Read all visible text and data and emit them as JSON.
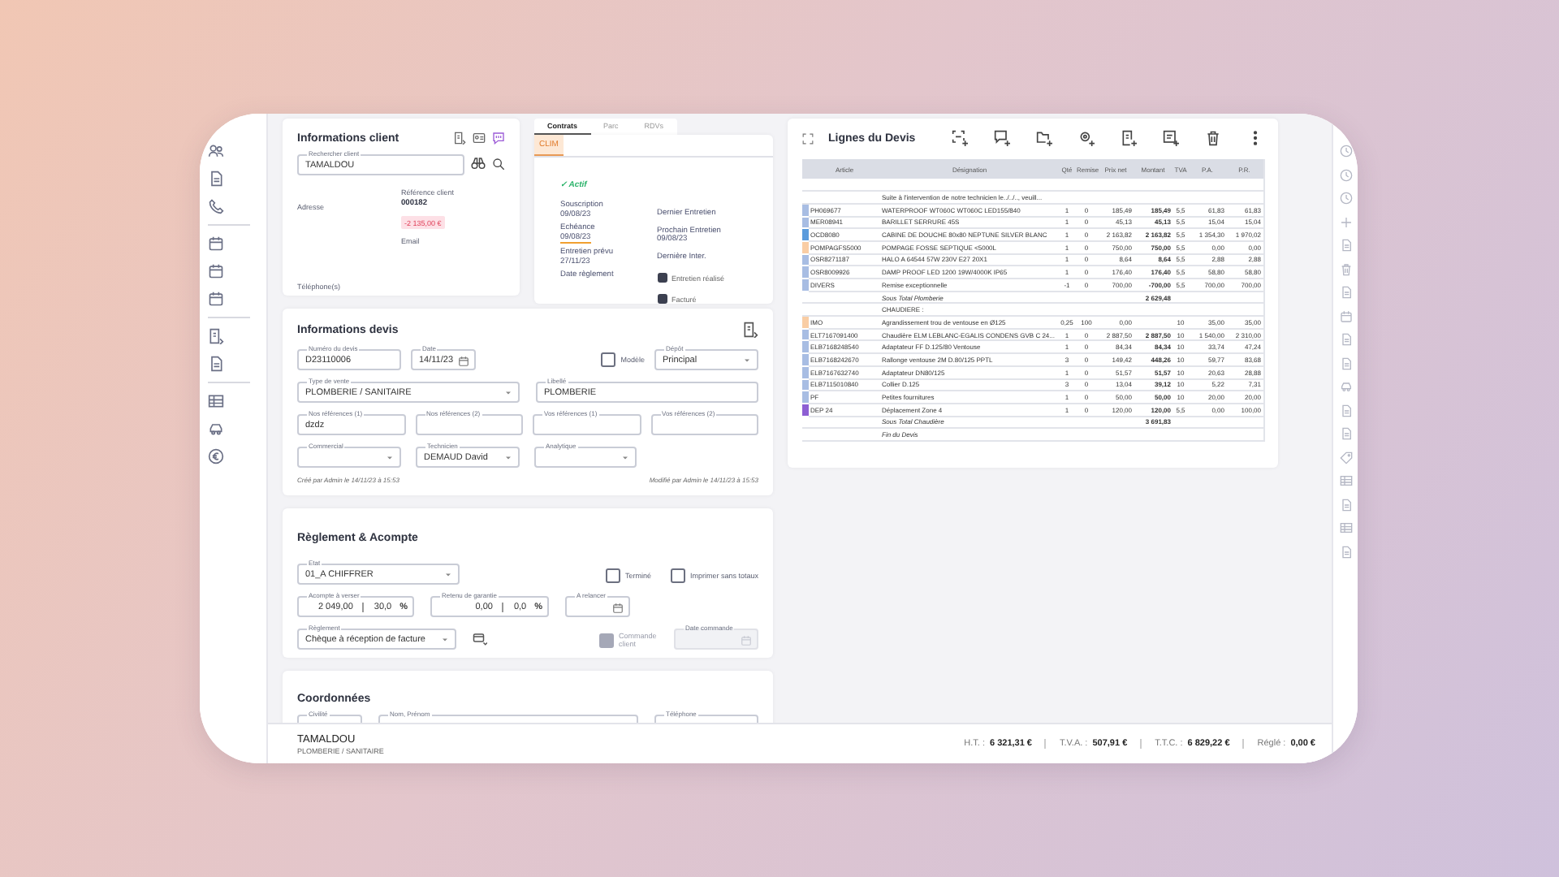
{
  "client": {
    "title": "Informations client",
    "search": {
      "label": "Rechercher client",
      "value": "TAMALDOU"
    },
    "address_label": "Adresse",
    "reference_label": "Référence client",
    "reference": "000182",
    "balance": "-2 135,00 €",
    "email_label": "Email",
    "phone_label": "Téléphone(s)"
  },
  "contracts": {
    "tabs": [
      {
        "label": "Contrats",
        "selected": true
      },
      {
        "label": "Parc",
        "selected": false
      },
      {
        "label": "RDVs",
        "selected": false
      }
    ],
    "contract_tabs": [
      {
        "label": "CLIM",
        "selected": true
      }
    ],
    "status": "✓ Actif",
    "left_fields": [
      {
        "label": "Souscription",
        "value": "09/08/23",
        "highlighted": false
      },
      {
        "label": "Echéance",
        "value": "09/08/23",
        "highlighted": true
      },
      {
        "label": "Entretien prévu",
        "value": "27/11/23",
        "highlighted": false
      },
      {
        "label": "Date règlement",
        "highlighted": false
      }
    ],
    "right_fields": [
      {
        "label": "Dernier Entretien"
      },
      {
        "label": "Prochain Entretien",
        "value": "09/08/23"
      },
      {
        "label": "Dernière Inter."
      }
    ],
    "checks": [
      {
        "label": "Entretien réalisé",
        "checked": true
      },
      {
        "label": "Facturé",
        "checked": true
      }
    ]
  },
  "devis": {
    "title": "Informations devis",
    "fields": [
      {
        "kind": "text",
        "label": "Numéro du devis",
        "value": "D23110006"
      },
      {
        "kind": "date",
        "label": "Date",
        "value": "14/11/23"
      },
      {
        "kind": "checkbox",
        "label": "Modèle",
        "checked": false
      },
      {
        "kind": "select",
        "label": "Dépôt",
        "value": "Principal"
      },
      {
        "kind": "select",
        "label": "Type de vente",
        "value": "PLOMBERIE / SANITAIRE"
      },
      {
        "kind": "text",
        "label": "Libellé",
        "value": "PLOMBERIE"
      },
      {
        "kind": "text",
        "label": "Nos références (1)",
        "value": "dzdz"
      },
      {
        "kind": "text",
        "label": "Nos références (2)"
      },
      {
        "kind": "text",
        "label": "Vos références (1)"
      },
      {
        "kind": "text",
        "label": "Vos références (2)"
      },
      {
        "kind": "select",
        "label": "Commercial"
      },
      {
        "kind": "select",
        "label": "Technicien",
        "value": "DEMAUD David"
      },
      {
        "kind": "select",
        "label": "Analytique"
      }
    ],
    "created": "Créé par Admin le 14/11/23 à 15:53",
    "modified": "Modifié par Admin le 14/11/23 à 15:53"
  },
  "reglement": {
    "title": "Règlement & Acompte",
    "status": {
      "label": "Etat",
      "value": "01_A CHIFFRER"
    },
    "options": [
      {
        "label": "Terminé",
        "checked": false
      },
      {
        "label": "Imprimer sans totaux",
        "checked": false
      }
    ],
    "deposit": {
      "label": "Acompte à verser",
      "amount": "2 049,00",
      "percent": "30,0",
      "unit": "%"
    },
    "retention": {
      "label": "Retenu de garantie",
      "amount": "0,00",
      "percent": "0,0",
      "unit": "%"
    },
    "reminder": {
      "label": "A relancer"
    },
    "payment": {
      "label": "Règlement",
      "value": "Chèque à réception de facture"
    },
    "order": {
      "label": "Commande client",
      "disabled": true
    },
    "order_date": {
      "label": "Date commande",
      "disabled": true
    }
  },
  "coordinates": {
    "title": "Coordonnées",
    "fields": [
      {
        "label": "Civilité"
      },
      {
        "label": "Nom, Prénom"
      },
      {
        "label": "Téléphone"
      }
    ]
  },
  "lines": {
    "title": "Lignes du Devis",
    "columns": [
      "Article",
      "Désignation",
      "Qté",
      "Remise",
      "Prix net",
      "Montant",
      "TVA",
      "P.A.",
      "P.R."
    ],
    "rows": [
      {
        "kind": "blank"
      },
      {
        "kind": "comment",
        "text": "Suite à l'intervention de notre technicien le../../.., veuill..."
      },
      {
        "kind": "item",
        "color": "#a8bde3",
        "cells": [
          "PH069677",
          "WATERPROOF WT060C WT060C LED155/840",
          "1",
          "0",
          "185,49",
          "185,49",
          "5,5",
          "61,83",
          "61,83"
        ]
      },
      {
        "kind": "item",
        "color": "#a8bde3",
        "cells": [
          "MER08941",
          "BARILLET SERRURE 45S",
          "1",
          "0",
          "45,13",
          "45,13",
          "5,5",
          "15,04",
          "15,04"
        ]
      },
      {
        "kind": "item",
        "color": "#5b9bdc",
        "cells": [
          "OCD8080",
          "CABINE DE DOUCHE 80x80 NEPTUNE SILVER BLANC",
          "1",
          "0",
          "2 163,82",
          "2 163,82",
          "5,5",
          "1 354,30",
          "1 970,02"
        ]
      },
      {
        "kind": "item",
        "color": "#f9cda4",
        "cells": [
          "POMPAGFS5000",
          "POMPAGE FOSSE SEPTIQUE <5000L",
          "1",
          "0",
          "750,00",
          "750,00",
          "5,5",
          "0,00",
          "0,00"
        ]
      },
      {
        "kind": "item",
        "color": "#a8bde3",
        "cells": [
          "OSR8271187",
          "HALO A 64544 57W 230V E27 20X1",
          "1",
          "0",
          "8,64",
          "8,64",
          "5,5",
          "2,88",
          "2,88"
        ]
      },
      {
        "kind": "item",
        "color": "#a8bde3",
        "cells": [
          "OSR8009926",
          "DAMP PROOF LED 1200 19W/4000K IP65",
          "1",
          "0",
          "176,40",
          "176,40",
          "5,5",
          "58,80",
          "58,80"
        ]
      },
      {
        "kind": "item",
        "color": "#a8bde3",
        "cells": [
          "DIVERS",
          "Remise exceptionnelle",
          "-1",
          "0",
          "700,00",
          "-700,00",
          "5,5",
          "700,00",
          "700,00"
        ]
      },
      {
        "kind": "subtotal",
        "label": "Sous Total Plomberie",
        "amount": "2 629,48"
      },
      {
        "kind": "section",
        "label": "CHAUDIERE :"
      },
      {
        "kind": "item",
        "color": "#f9cda4",
        "cells": [
          "IMO",
          "Agrandissement trou de ventouse en Ø125",
          "0,25",
          "100",
          "0,00",
          "",
          "10",
          "35,00",
          "35,00"
        ]
      },
      {
        "kind": "item",
        "color": "#a8bde3",
        "cells": [
          "ELT7167091400",
          "Chaudière ELM LEBLANC-EGALIS CONDENS GVB C 24...",
          "1",
          "0",
          "2 887,50",
          "2 887,50",
          "10",
          "1 540,00",
          "2 310,00"
        ]
      },
      {
        "kind": "item",
        "color": "#a8bde3",
        "cells": [
          "ELB7168248540",
          "Adaptateur FF D.125/80 Ventouse",
          "1",
          "0",
          "84,34",
          "84,34",
          "10",
          "33,74",
          "47,24"
        ]
      },
      {
        "kind": "item",
        "color": "#a8bde3",
        "cells": [
          "ELB7168242670",
          "Rallonge ventouse 2M D.80/125 PPTL",
          "3",
          "0",
          "149,42",
          "448,26",
          "10",
          "59,77",
          "83,68"
        ]
      },
      {
        "kind": "item",
        "color": "#a8bde3",
        "cells": [
          "ELB7167632740",
          "Adaptateur DN80/125",
          "1",
          "0",
          "51,57",
          "51,57",
          "10",
          "20,63",
          "28,88"
        ]
      },
      {
        "kind": "item",
        "color": "#a8bde3",
        "cells": [
          "ELB7115010840",
          "Collier D.125",
          "3",
          "0",
          "13,04",
          "39,12",
          "10",
          "5,22",
          "7,31"
        ]
      },
      {
        "kind": "item",
        "color": "#a8bde3",
        "cells": [
          "PF",
          "Petites fournitures",
          "1",
          "0",
          "50,00",
          "50,00",
          "10",
          "20,00",
          "20,00"
        ]
      },
      {
        "kind": "item",
        "color": "#8d5fd3",
        "cells": [
          "DEP 24",
          "Déplacement Zone 4",
          "1",
          "0",
          "120,00",
          "120,00",
          "5,5",
          "0,00",
          "100,00"
        ]
      },
      {
        "kind": "subtotal",
        "label": "Sous Total Chaudière",
        "amount": "3 691,83"
      },
      {
        "kind": "end",
        "label": "Fin du Devis"
      }
    ]
  },
  "footer": {
    "client": "TAMALDOU",
    "sale_type": "PLOMBERIE / SANITAIRE",
    "totals": [
      {
        "label": "H.T. :",
        "value": "6 321,31 €"
      },
      {
        "label": "T.V.A. :",
        "value": "507,91 €"
      },
      {
        "label": "T.T.C. :",
        "value": "6 829,22 €"
      },
      {
        "label": "Réglé :",
        "value": "0,00 €"
      }
    ]
  }
}
